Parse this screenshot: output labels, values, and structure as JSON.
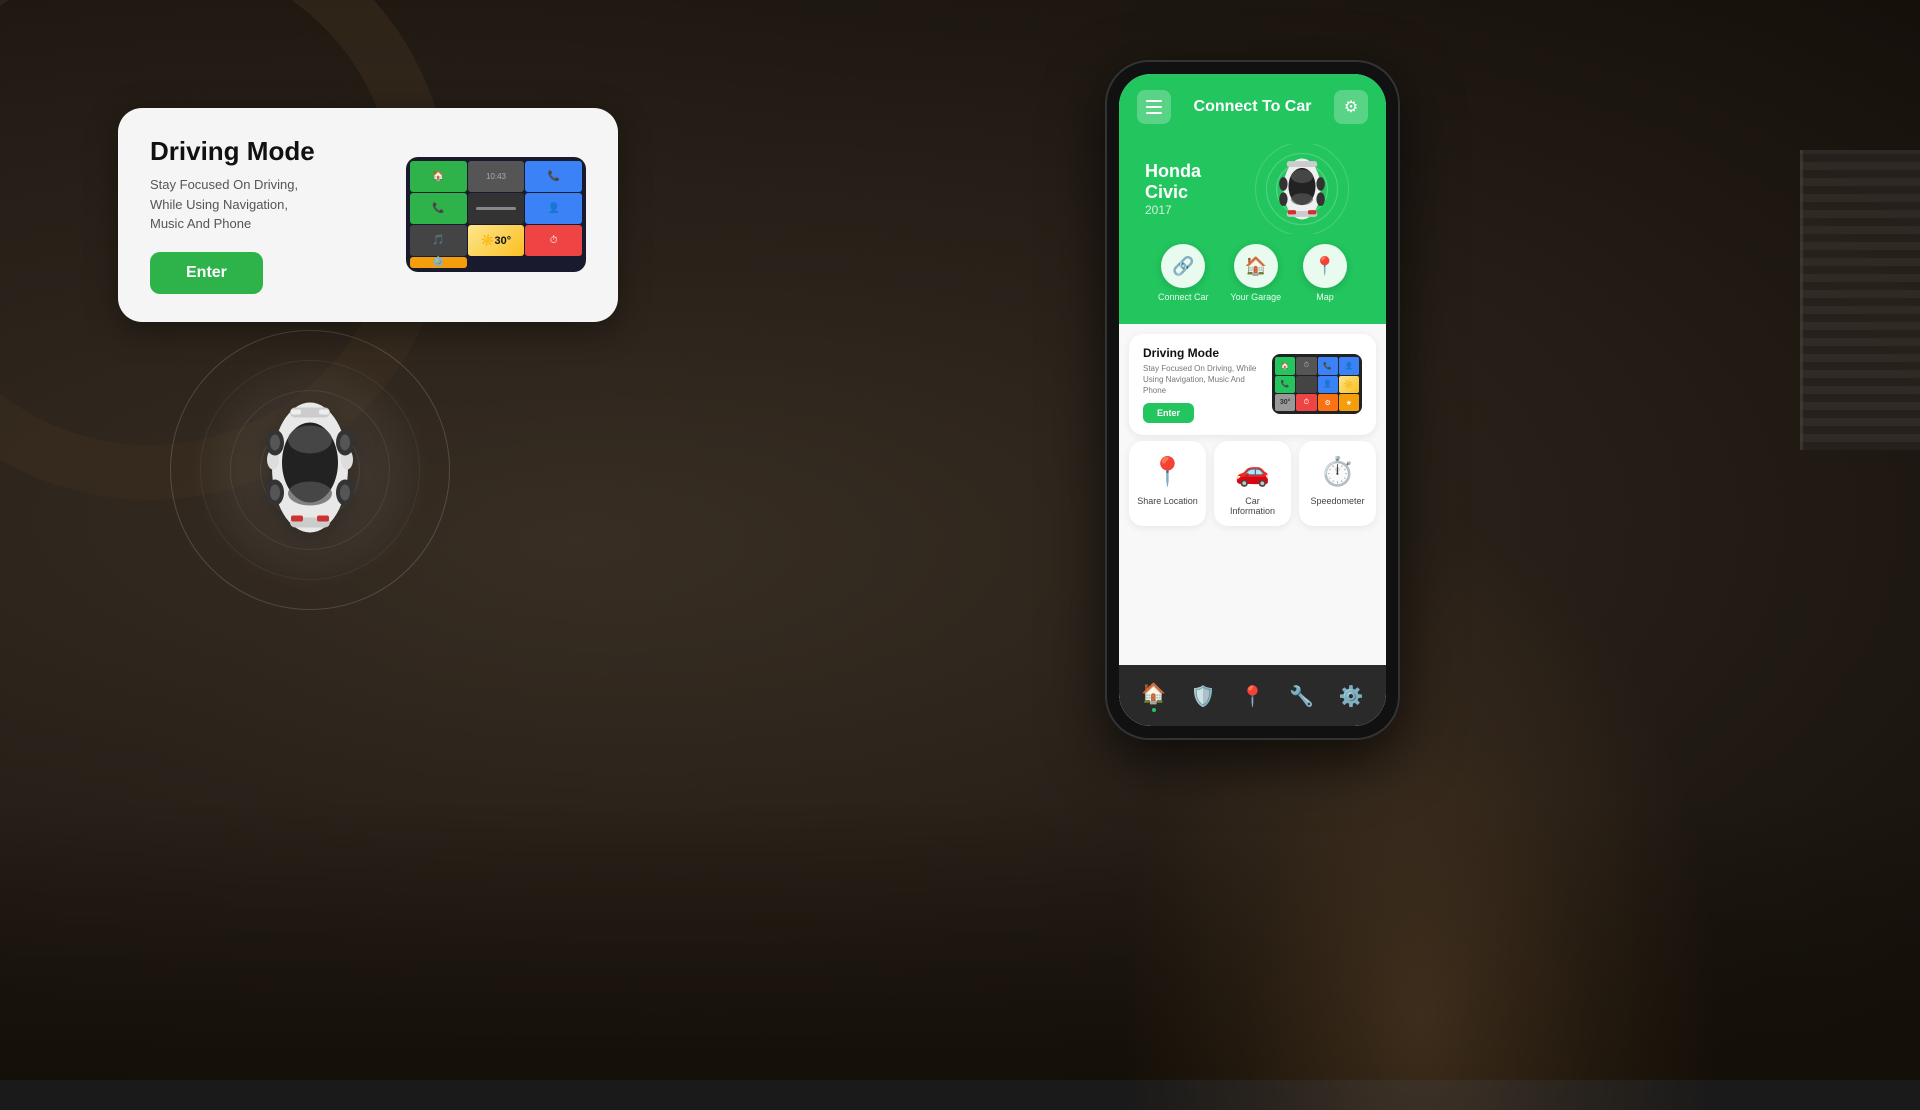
{
  "background": {
    "color": "#1a1208"
  },
  "driving_mode_card": {
    "title": "Driving Mode",
    "description_line1": "Stay Focused On Driving,",
    "description_line2": "While Using Navigation,",
    "description_line3": "Music And Phone",
    "enter_button": "Enter"
  },
  "phone": {
    "header": {
      "connect_title": "Connect To Car",
      "menu_aria": "Menu",
      "settings_aria": "Settings"
    },
    "car_info": {
      "name": "Honda Civic",
      "year": "2017"
    },
    "quick_actions": [
      {
        "label": "Connect Car",
        "icon": "🔗"
      },
      {
        "label": "Your Garage",
        "icon": "🏠"
      },
      {
        "label": "Map",
        "icon": "📍"
      }
    ],
    "driving_mode": {
      "title": "Driving Mode",
      "description": "Stay Focused On Driving, While Using Navigation, Music And Phone",
      "enter_button": "Enter"
    },
    "grid_items": [
      {
        "label": "Share Location",
        "icon": "📍"
      },
      {
        "label": "Car Information",
        "icon": "🚗"
      },
      {
        "label": "Speedometer",
        "icon": "⏱️"
      }
    ],
    "nav_items": [
      {
        "label": "Home",
        "icon": "🏠",
        "active": true
      },
      {
        "label": "Shield",
        "icon": "🛡️",
        "active": false
      },
      {
        "label": "Location",
        "icon": "📍",
        "active": false
      },
      {
        "label": "Garage",
        "icon": "🔧",
        "active": false
      },
      {
        "label": "Settings",
        "icon": "⚙️",
        "active": false
      }
    ]
  },
  "colors": {
    "green": "#22c55e",
    "dark": "#111111",
    "card_bg": "#f5f5f5",
    "white": "#ffffff"
  }
}
